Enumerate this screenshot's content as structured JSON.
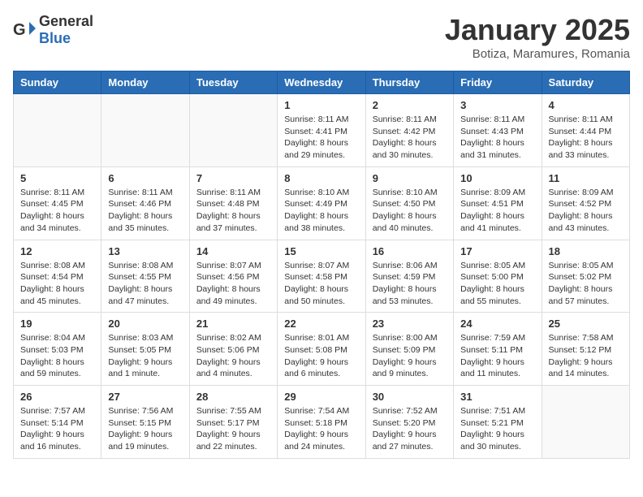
{
  "header": {
    "logo_general": "General",
    "logo_blue": "Blue",
    "title": "January 2025",
    "subtitle": "Botiza, Maramures, Romania"
  },
  "weekdays": [
    "Sunday",
    "Monday",
    "Tuesday",
    "Wednesday",
    "Thursday",
    "Friday",
    "Saturday"
  ],
  "weeks": [
    [
      {
        "day": "",
        "info": ""
      },
      {
        "day": "",
        "info": ""
      },
      {
        "day": "",
        "info": ""
      },
      {
        "day": "1",
        "info": "Sunrise: 8:11 AM\nSunset: 4:41 PM\nDaylight: 8 hours and 29 minutes."
      },
      {
        "day": "2",
        "info": "Sunrise: 8:11 AM\nSunset: 4:42 PM\nDaylight: 8 hours and 30 minutes."
      },
      {
        "day": "3",
        "info": "Sunrise: 8:11 AM\nSunset: 4:43 PM\nDaylight: 8 hours and 31 minutes."
      },
      {
        "day": "4",
        "info": "Sunrise: 8:11 AM\nSunset: 4:44 PM\nDaylight: 8 hours and 33 minutes."
      }
    ],
    [
      {
        "day": "5",
        "info": "Sunrise: 8:11 AM\nSunset: 4:45 PM\nDaylight: 8 hours and 34 minutes."
      },
      {
        "day": "6",
        "info": "Sunrise: 8:11 AM\nSunset: 4:46 PM\nDaylight: 8 hours and 35 minutes."
      },
      {
        "day": "7",
        "info": "Sunrise: 8:11 AM\nSunset: 4:48 PM\nDaylight: 8 hours and 37 minutes."
      },
      {
        "day": "8",
        "info": "Sunrise: 8:10 AM\nSunset: 4:49 PM\nDaylight: 8 hours and 38 minutes."
      },
      {
        "day": "9",
        "info": "Sunrise: 8:10 AM\nSunset: 4:50 PM\nDaylight: 8 hours and 40 minutes."
      },
      {
        "day": "10",
        "info": "Sunrise: 8:09 AM\nSunset: 4:51 PM\nDaylight: 8 hours and 41 minutes."
      },
      {
        "day": "11",
        "info": "Sunrise: 8:09 AM\nSunset: 4:52 PM\nDaylight: 8 hours and 43 minutes."
      }
    ],
    [
      {
        "day": "12",
        "info": "Sunrise: 8:08 AM\nSunset: 4:54 PM\nDaylight: 8 hours and 45 minutes."
      },
      {
        "day": "13",
        "info": "Sunrise: 8:08 AM\nSunset: 4:55 PM\nDaylight: 8 hours and 47 minutes."
      },
      {
        "day": "14",
        "info": "Sunrise: 8:07 AM\nSunset: 4:56 PM\nDaylight: 8 hours and 49 minutes."
      },
      {
        "day": "15",
        "info": "Sunrise: 8:07 AM\nSunset: 4:58 PM\nDaylight: 8 hours and 50 minutes."
      },
      {
        "day": "16",
        "info": "Sunrise: 8:06 AM\nSunset: 4:59 PM\nDaylight: 8 hours and 53 minutes."
      },
      {
        "day": "17",
        "info": "Sunrise: 8:05 AM\nSunset: 5:00 PM\nDaylight: 8 hours and 55 minutes."
      },
      {
        "day": "18",
        "info": "Sunrise: 8:05 AM\nSunset: 5:02 PM\nDaylight: 8 hours and 57 minutes."
      }
    ],
    [
      {
        "day": "19",
        "info": "Sunrise: 8:04 AM\nSunset: 5:03 PM\nDaylight: 8 hours and 59 minutes."
      },
      {
        "day": "20",
        "info": "Sunrise: 8:03 AM\nSunset: 5:05 PM\nDaylight: 9 hours and 1 minute."
      },
      {
        "day": "21",
        "info": "Sunrise: 8:02 AM\nSunset: 5:06 PM\nDaylight: 9 hours and 4 minutes."
      },
      {
        "day": "22",
        "info": "Sunrise: 8:01 AM\nSunset: 5:08 PM\nDaylight: 9 hours and 6 minutes."
      },
      {
        "day": "23",
        "info": "Sunrise: 8:00 AM\nSunset: 5:09 PM\nDaylight: 9 hours and 9 minutes."
      },
      {
        "day": "24",
        "info": "Sunrise: 7:59 AM\nSunset: 5:11 PM\nDaylight: 9 hours and 11 minutes."
      },
      {
        "day": "25",
        "info": "Sunrise: 7:58 AM\nSunset: 5:12 PM\nDaylight: 9 hours and 14 minutes."
      }
    ],
    [
      {
        "day": "26",
        "info": "Sunrise: 7:57 AM\nSunset: 5:14 PM\nDaylight: 9 hours and 16 minutes."
      },
      {
        "day": "27",
        "info": "Sunrise: 7:56 AM\nSunset: 5:15 PM\nDaylight: 9 hours and 19 minutes."
      },
      {
        "day": "28",
        "info": "Sunrise: 7:55 AM\nSunset: 5:17 PM\nDaylight: 9 hours and 22 minutes."
      },
      {
        "day": "29",
        "info": "Sunrise: 7:54 AM\nSunset: 5:18 PM\nDaylight: 9 hours and 24 minutes."
      },
      {
        "day": "30",
        "info": "Sunrise: 7:52 AM\nSunset: 5:20 PM\nDaylight: 9 hours and 27 minutes."
      },
      {
        "day": "31",
        "info": "Sunrise: 7:51 AM\nSunset: 5:21 PM\nDaylight: 9 hours and 30 minutes."
      },
      {
        "day": "",
        "info": ""
      }
    ]
  ]
}
